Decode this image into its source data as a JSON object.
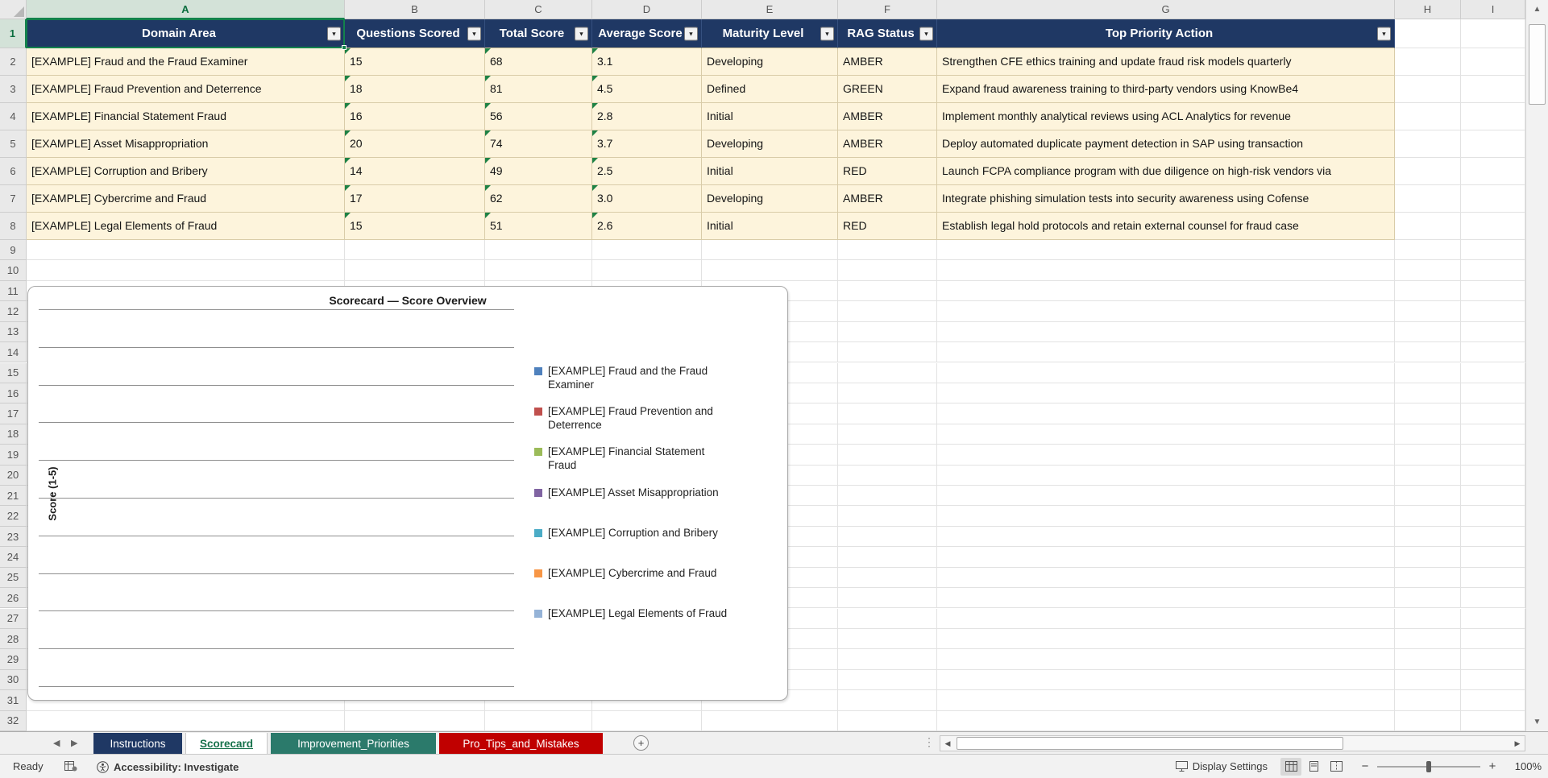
{
  "window": {
    "columns": [
      "A",
      "B",
      "C",
      "D",
      "E",
      "F",
      "G",
      "H",
      "I"
    ],
    "row_count": 32,
    "selected_cell": "A1"
  },
  "table": {
    "header_bg": "#1F3864",
    "row_bg": "#FDF4DC",
    "headers": [
      "Domain Area",
      "Questions Scored",
      "Total Score",
      "Average Score",
      "Maturity Level",
      "RAG Status",
      "Top Priority Action"
    ],
    "rows": [
      [
        "[EXAMPLE] Fraud and the Fraud Examiner",
        "15",
        "68",
        "3.1",
        "Developing",
        "AMBER",
        "Strengthen CFE ethics training and update fraud risk models quarterly"
      ],
      [
        "[EXAMPLE] Fraud Prevention and Deterrence",
        "18",
        "81",
        "4.5",
        "Defined",
        "GREEN",
        "Expand fraud awareness training to third-party vendors using KnowBe4"
      ],
      [
        "[EXAMPLE] Financial Statement Fraud",
        "16",
        "56",
        "2.8",
        "Initial",
        "AMBER",
        "Implement monthly analytical reviews using ACL Analytics for revenue"
      ],
      [
        "[EXAMPLE] Asset Misappropriation",
        "20",
        "74",
        "3.7",
        "Developing",
        "AMBER",
        "Deploy automated duplicate payment detection in SAP using transaction"
      ],
      [
        "[EXAMPLE] Corruption and Bribery",
        "14",
        "49",
        "2.5",
        "Initial",
        "RED",
        "Launch FCPA compliance program with due diligence on high-risk vendors via"
      ],
      [
        "[EXAMPLE] Cybercrime and Fraud",
        "17",
        "62",
        "3.0",
        "Developing",
        "AMBER",
        "Integrate phishing simulation tests into security awareness using Cofense"
      ],
      [
        "[EXAMPLE] Legal Elements of Fraud",
        "15",
        "51",
        "2.6",
        "Initial",
        "RED",
        "Establish legal hold protocols and retain external counsel for fraud case"
      ]
    ]
  },
  "chart_data": {
    "type": "bar",
    "title": "Scorecard — Score Overview",
    "ylabel": "Score (1-5)",
    "ylim": [
      0,
      5
    ],
    "gridlines": 11,
    "legend_position": "right",
    "bars_visible": false,
    "series": [
      {
        "name": "[EXAMPLE] Fraud and the Fraud Examiner",
        "color": "#4F81BD"
      },
      {
        "name": "[EXAMPLE] Fraud Prevention and Deterrence",
        "color": "#C0504D"
      },
      {
        "name": "[EXAMPLE] Financial Statement Fraud",
        "color": "#9BBB59"
      },
      {
        "name": "[EXAMPLE] Asset Misappropriation",
        "color": "#8064A2"
      },
      {
        "name": "[EXAMPLE] Corruption and Bribery",
        "color": "#4BACC6"
      },
      {
        "name": "[EXAMPLE] Cybercrime and Fraud",
        "color": "#F79646"
      },
      {
        "name": "[EXAMPLE] Legal Elements of Fraud",
        "color": "#95B3D7"
      }
    ]
  },
  "sheet_tabs": {
    "tabs": [
      {
        "label": "Instructions",
        "bg": "#1F3864",
        "fg": "#FFFFFF",
        "active": false
      },
      {
        "label": "Scorecard",
        "bg": "#FFFFFF",
        "fg": "#15714A",
        "active": true
      },
      {
        "label": "Improvement_Priorities",
        "bg": "#2B7A6B",
        "fg": "#FFFFFF",
        "active": false
      },
      {
        "label": "Pro_Tips_and_Mistakes",
        "bg": "#C00000",
        "fg": "#FFFFFF",
        "active": false
      }
    ],
    "add_sheet_label": "+"
  },
  "status_bar": {
    "mode": "Ready",
    "accessibility": "Accessibility: Investigate",
    "display_settings": "Display Settings",
    "zoom": "100%"
  }
}
